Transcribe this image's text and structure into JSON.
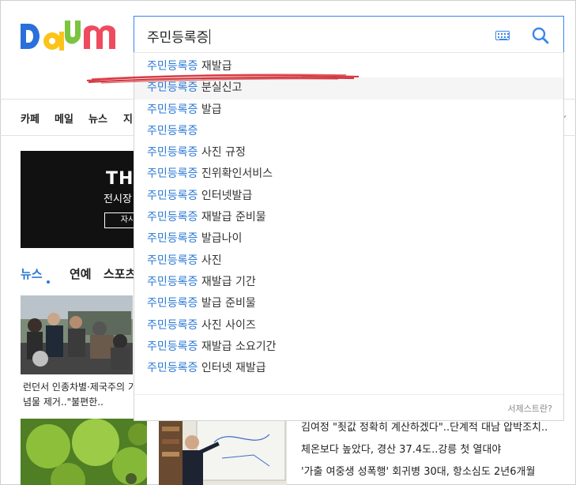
{
  "logo": {
    "text": "Daum",
    "colors": [
      "#2a6fdb",
      "#fcc419",
      "#7cc440",
      "#ee4b60"
    ]
  },
  "search": {
    "value": "주민등록증",
    "keyboard_icon": "keyboard-icon",
    "search_icon": "magnifier-icon",
    "accent": "#3b86e8"
  },
  "suggestions": {
    "keyword": "주민등록증",
    "items": [
      {
        "kw": "주민등록증",
        "rest": " 재발급"
      },
      {
        "kw": "주민등록증",
        "rest": " 분실신고"
      },
      {
        "kw": "주민등록증",
        "rest": " 발급"
      },
      {
        "kw": "주민등록증",
        "rest": ""
      },
      {
        "kw": "주민등록증",
        "rest": " 사진 규정"
      },
      {
        "kw": "주민등록증",
        "rest": " 진위확인서비스"
      },
      {
        "kw": "주민등록증",
        "rest": " 인터넷발급"
      },
      {
        "kw": "주민등록증",
        "rest": " 재발급 준비물"
      },
      {
        "kw": "주민등록증",
        "rest": " 발급나이"
      },
      {
        "kw": "주민등록증",
        "rest": " 사진"
      },
      {
        "kw": "주민등록증",
        "rest": " 재발급 기간"
      },
      {
        "kw": "주민등록증",
        "rest": " 발급 준비물"
      },
      {
        "kw": "주민등록증",
        "rest": " 사진 사이즈"
      },
      {
        "kw": "주민등록증",
        "rest": " 재발급 소요기간"
      },
      {
        "kw": "주민등록증",
        "rest": " 인터넷 재발급"
      }
    ],
    "footer_link": "서제스트란?",
    "keyword_color": "#2a79d7"
  },
  "nav": {
    "items": [
      "카페",
      "메일",
      "뉴스",
      "지"
    ],
    "more": "⌄"
  },
  "banner": {
    "title": "THI",
    "subtitle": "전시장",
    "button": "자시"
  },
  "tabs": {
    "items": [
      "뉴스",
      "연예",
      "스포츠"
    ],
    "active_color": "#2a79d7"
  },
  "news": {
    "caption": "런던서 인종차별·제국주의 기념물 제거..\"불편한..",
    "headlines": [
      "김여정 \"죗값 정확히 계산하겠다\"..단계적 대남 압박조치..",
      "체온보다 높았다, 경산 37.4도..강릉 첫 열대야",
      "'가출 여중생 성폭행' 회귀병 30대, 항소심도 2년6개월"
    ]
  }
}
